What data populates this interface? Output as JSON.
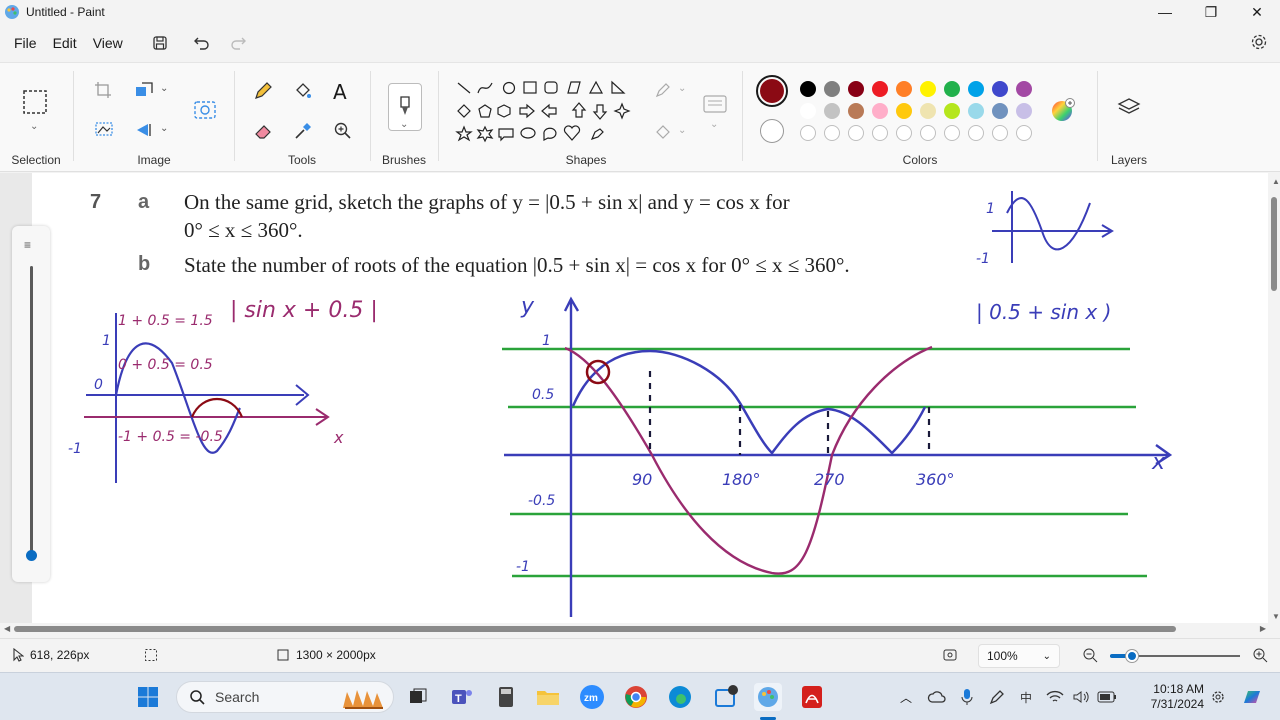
{
  "window": {
    "title": "Untitled - Paint",
    "minimize_glyph": "—",
    "maximize_glyph": "❐",
    "close_glyph": "✕"
  },
  "menu": {
    "file": "File",
    "edit": "Edit",
    "view": "View"
  },
  "ribbon": {
    "selection_label": "Selection",
    "image_label": "Image",
    "tools_label": "Tools",
    "brushes_label": "Brushes",
    "shapes_label": "Shapes",
    "colors_label": "Colors",
    "layers_label": "Layers",
    "tool_text_glyph": "A",
    "primary_color": "#8b0a14",
    "palette_row1": [
      "#000000",
      "#7f7f7f",
      "#880015",
      "#ed1c24",
      "#ff7f27",
      "#fff200",
      "#22b14c",
      "#00a2e8",
      "#3f48cc",
      "#a349a4"
    ],
    "palette_row2": [
      "#ffffff",
      "#c3c3c3",
      "#b97a57",
      "#ffaec9",
      "#ffc90e",
      "#efe4b0",
      "#b5e61d",
      "#99d9ea",
      "#7092be",
      "#c8bfe7"
    ]
  },
  "document": {
    "question_number": "7",
    "part_a_letter": "a",
    "part_a_line1": "On the same grid, sketch the graphs of y = |0.5 + sin x| and y = cos x for",
    "part_a_line2": "0° ≤ x ≤ 360°.",
    "part_b_letter": "b",
    "part_b_line": "State the number of roots of the equation |0.5 + sin x| = cos x for 0° ≤ x ≤ 360°."
  },
  "annotations": {
    "left_title": "| sin x + 0.5 |",
    "left_top": "1 + 0.5 = 1.5",
    "left_mid": "0 + 0.5 = 0.5",
    "left_one": "1",
    "left_zero": "0",
    "left_neg_one": "-1",
    "left_bottom": "-1 + 0.5 = -0.5",
    "left_x": "x",
    "main_y": "y",
    "main_x": "x",
    "main_title": "| 0.5 + sin x )",
    "tick_1": "1",
    "tick_05": "0.5",
    "tick_neg05": "-0.5",
    "tick_neg1": "-1",
    "tick_90": "90",
    "tick_180": "180°",
    "tick_270": "270",
    "tick_360": "360°",
    "corner_1": "1",
    "corner_neg1": "-1"
  },
  "status": {
    "cursor_pos": "618, 226px",
    "canvas_size": "1300 × 2000px",
    "zoom": "100%"
  },
  "taskbar": {
    "search_placeholder": "Search",
    "time": "10:18 AM",
    "date": "7/31/2024"
  }
}
